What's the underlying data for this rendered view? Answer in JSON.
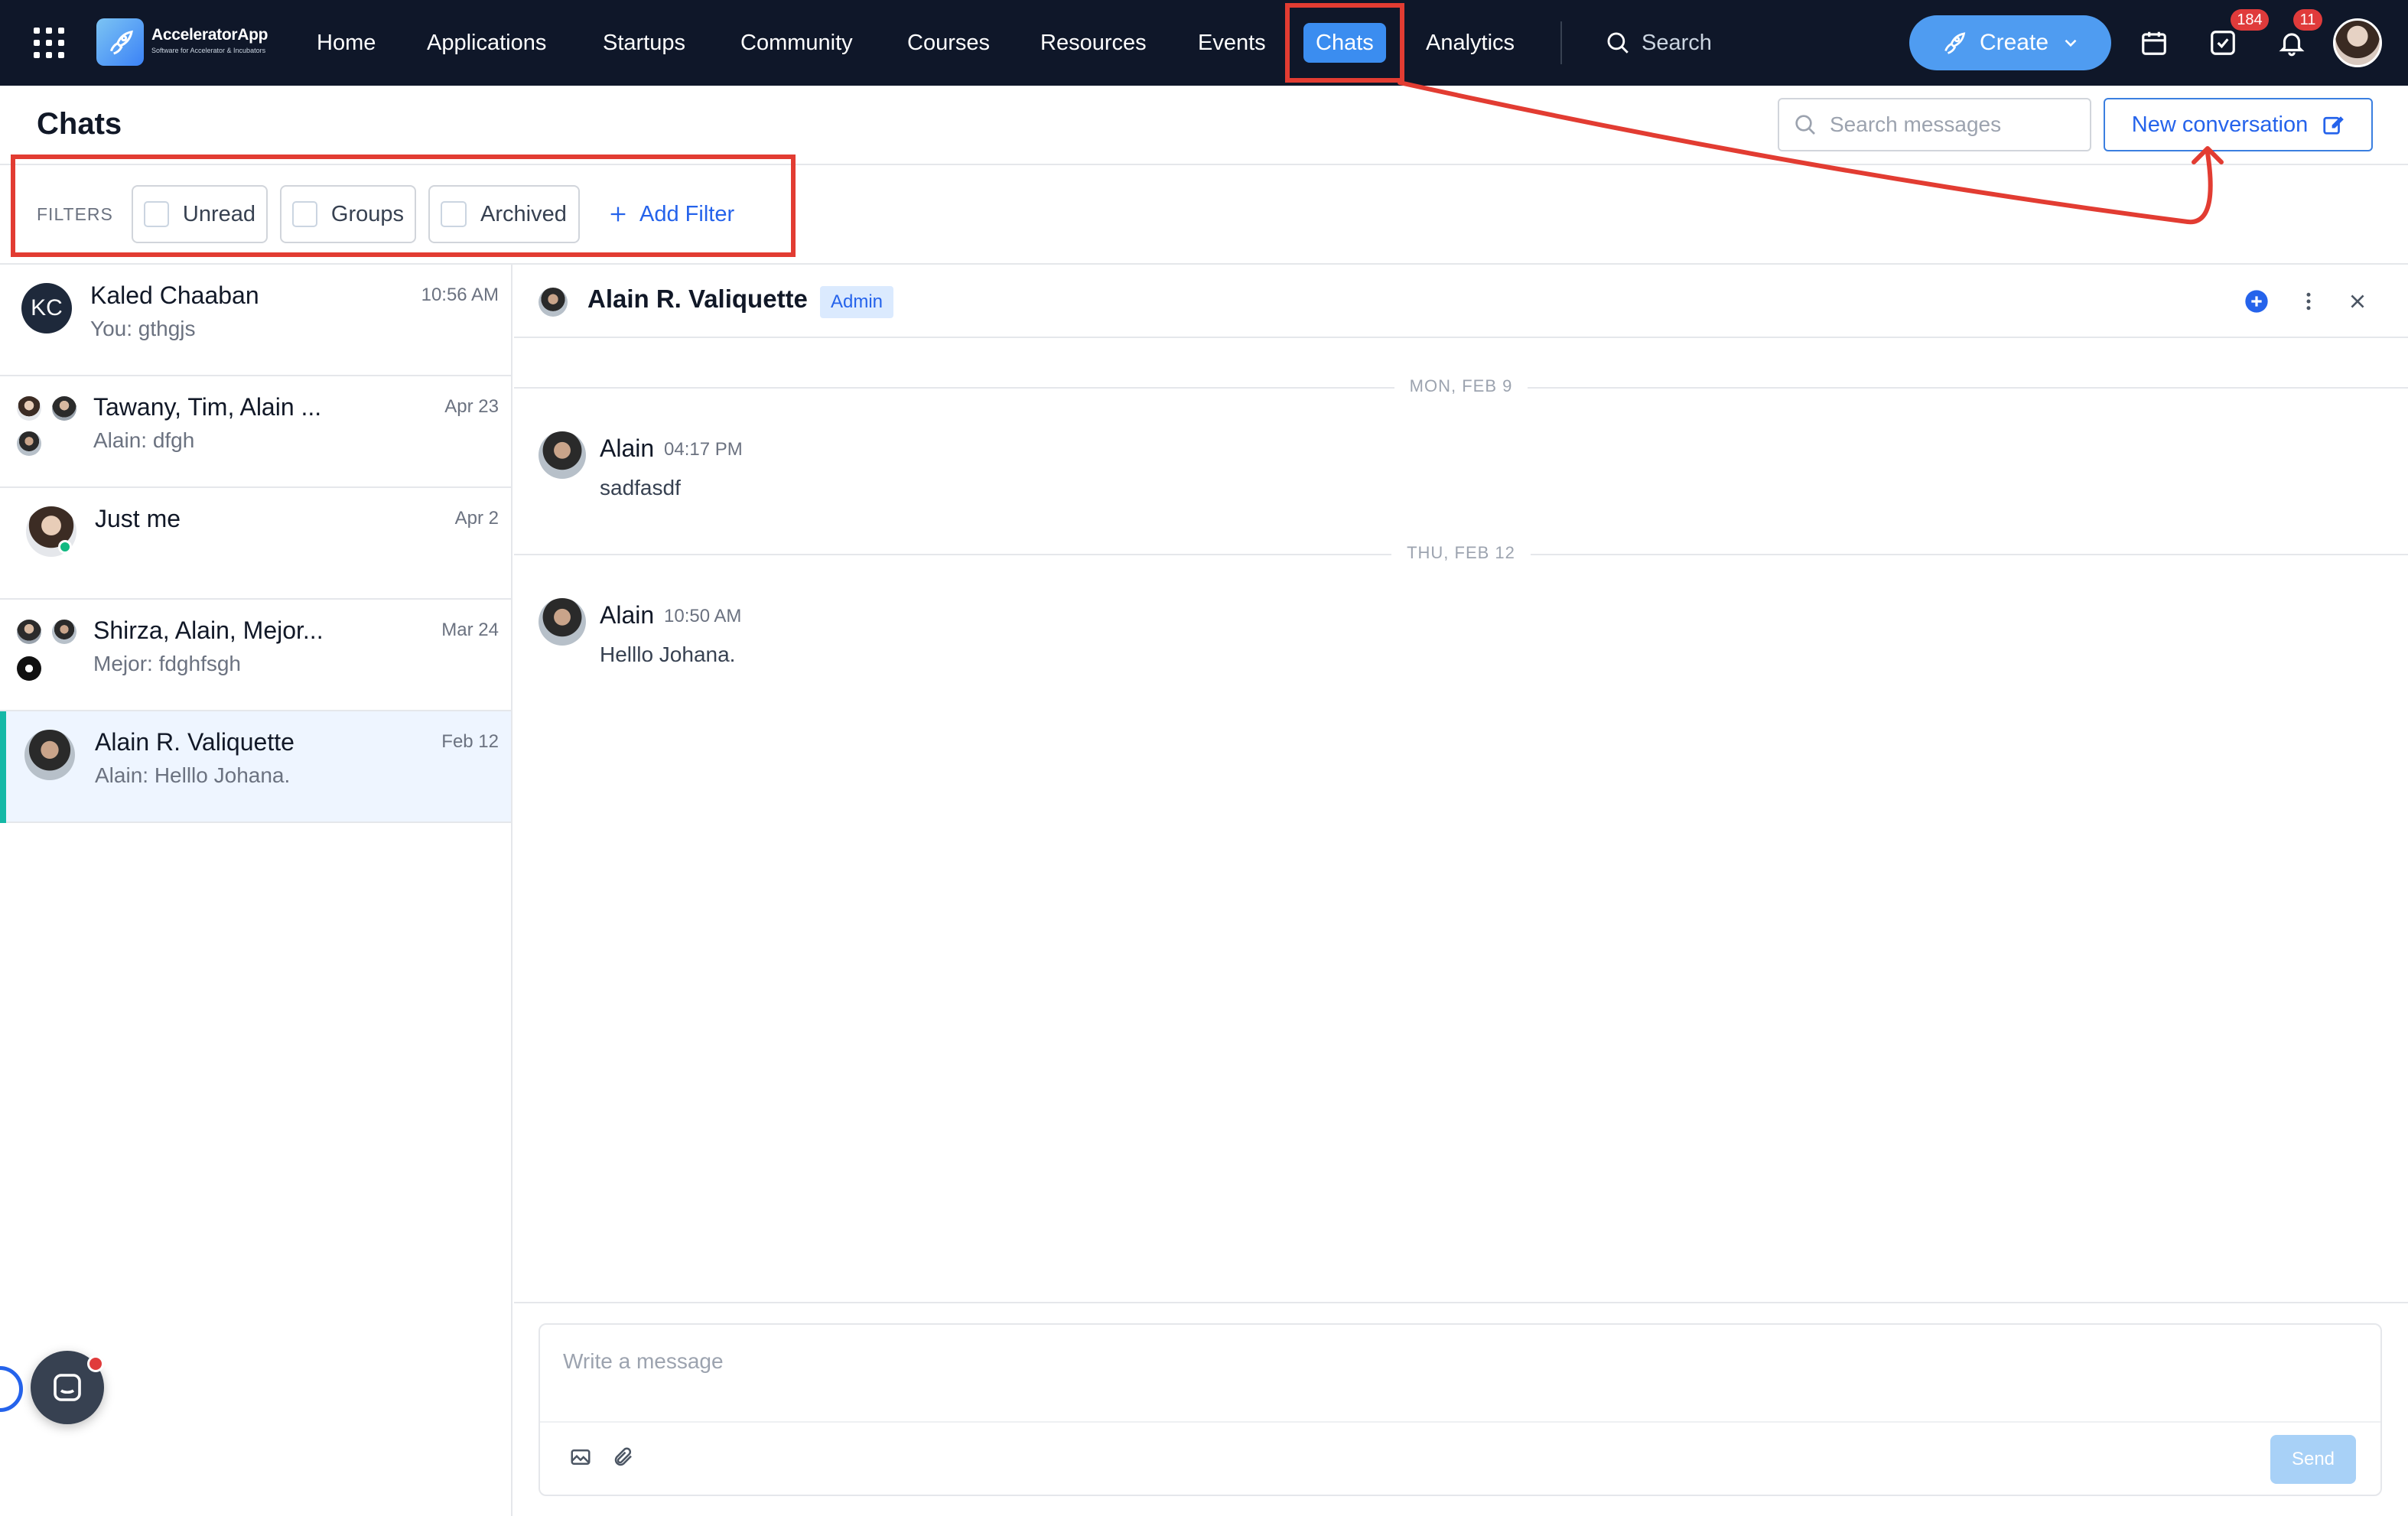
{
  "app": {
    "name": "AcceleratorApp",
    "tagline": "Software for Accelerator & Incubators"
  },
  "nav": {
    "items": [
      "Home",
      "Applications",
      "Startups",
      "Community",
      "Courses",
      "Resources",
      "Events",
      "Chats",
      "Analytics"
    ],
    "active": "Chats",
    "search_label": "Search",
    "create_label": "Create",
    "tasks_badge": "184",
    "notifications_badge": "11"
  },
  "page": {
    "title": "Chats",
    "search_placeholder": "Search messages",
    "new_conversation_label": "New conversation"
  },
  "filters": {
    "label": "FILTERS",
    "options": [
      "Unread",
      "Groups",
      "Archived"
    ],
    "add_label": "Add Filter"
  },
  "conversations": [
    {
      "name": "Kaled Chaaban",
      "preview": "You: gthgjs",
      "time": "10:56 AM",
      "initials": "KC"
    },
    {
      "name": "Tawany, Tim, Alain ...",
      "preview": "Alain: dfgh",
      "time": "Apr 23"
    },
    {
      "name": "Just me",
      "preview": "",
      "time": "Apr 2"
    },
    {
      "name": "Shirza, Alain, Mejor...",
      "preview": "Mejor: fdghfsgh",
      "time": "Mar 24"
    },
    {
      "name": "Alain R. Valiquette",
      "preview": "Alain: Helllo Johana.",
      "time": "Feb 12",
      "selected": true
    }
  ],
  "chat": {
    "name": "Alain R. Valiquette",
    "role": "Admin",
    "days": [
      {
        "label": "MON, FEB 9",
        "messages": [
          {
            "author": "Alain",
            "time": "04:17 PM",
            "text": "sadfasdf"
          }
        ]
      },
      {
        "label": "THU, FEB 12",
        "messages": [
          {
            "author": "Alain",
            "time": "10:50 AM",
            "text": "Helllo Johana."
          }
        ]
      }
    ],
    "composer_placeholder": "Write a message",
    "send_label": "Send"
  },
  "colors": {
    "nav_bg": "#0f1729",
    "accent": "#3b8df0",
    "link": "#2563eb",
    "annotation": "#e23c32",
    "selected_bar": "#14b8a6"
  },
  "icons": [
    "apps-grid-icon",
    "rocket-icon",
    "search-icon",
    "chevron-down-icon",
    "calendar-icon",
    "task-check-icon",
    "bell-icon",
    "plus-icon",
    "edit-icon",
    "more-vertical-icon",
    "close-icon",
    "image-icon",
    "paperclip-icon",
    "chat-icon"
  ]
}
